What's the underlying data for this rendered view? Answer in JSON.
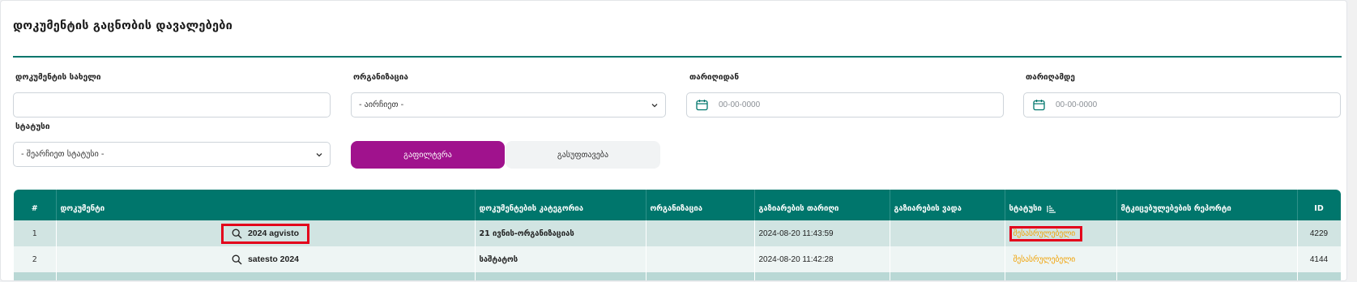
{
  "page": {
    "title": "დოკუმენტის გაცნობის დავალებები"
  },
  "filters": {
    "document_name": {
      "label": "დოკუმენტის სახელი",
      "value": ""
    },
    "organization": {
      "label": "ორგანიზაცია",
      "selected": "- აირჩიეთ -"
    },
    "date_from": {
      "label": "თარიღიდან",
      "placeholder": "00-00-0000"
    },
    "date_to": {
      "label": "თარიღამდე",
      "placeholder": "00-00-0000"
    },
    "status": {
      "label": "სტატუსი",
      "selected": "- შეარჩიეთ სტატუსი -"
    }
  },
  "buttons": {
    "filter": "გაფილტვრა",
    "reset": "გასუფთავება"
  },
  "table": {
    "headers": [
      "#",
      "დოკუმენტი",
      "დოკუმენტების კატეგორია",
      "ორგანიზაცია",
      "გაზიარების თარიღი",
      "გაზიარების ვადა",
      "სტატუსი",
      "მტკიცებულებების რეპორტი",
      "ID"
    ],
    "rows": [
      {
        "num": "1",
        "document": "2024 agvisto",
        "category": "21 ივნის-ორგანიზაციას",
        "organization": "",
        "shared_date": "2024-08-20 11:43:59",
        "deadline": "",
        "status": "შესასრულებელი",
        "report": "",
        "id": "4229"
      },
      {
        "num": "2",
        "document": "satesto 2024",
        "category": "საშტატოს",
        "organization": "",
        "shared_date": "2024-08-20 11:42:28",
        "deadline": "",
        "status": "შესასრულებელი",
        "report": "",
        "id": "4144"
      }
    ]
  },
  "colors": {
    "accent": "#00766c",
    "filter_button": "#a0128d",
    "status_pending": "#f0a000",
    "highlight": "#e3001b"
  }
}
